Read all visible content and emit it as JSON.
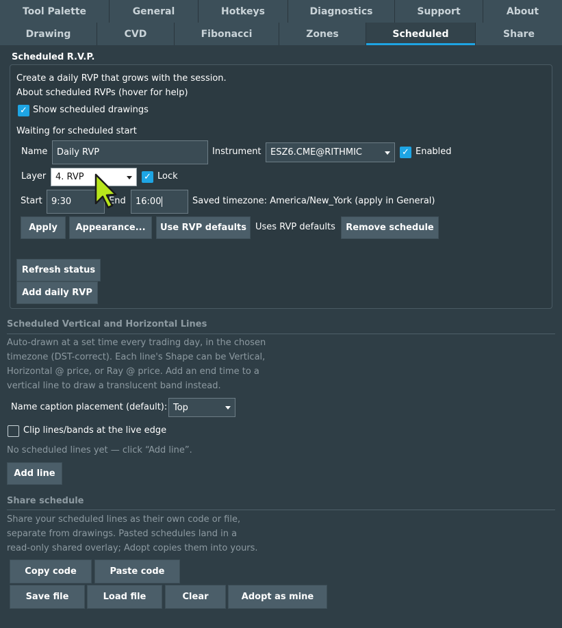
{
  "tabs_row1": [
    "Tool Palette",
    "General",
    "Hotkeys",
    "Diagnostics",
    "Support",
    "About"
  ],
  "tabs_row2": [
    "Drawing",
    "CVD",
    "Fibonacci",
    "Zones",
    "Scheduled",
    "Share"
  ],
  "active_tab": "Scheduled",
  "accent_color": "#1ea5e4",
  "rvp": {
    "title": "Scheduled R.V.P.",
    "intro": "Create a daily RVP that grows with the session.",
    "about": "About scheduled RVPs (hover for help)",
    "show_drawings_label": "Show scheduled drawings",
    "show_drawings_checked": true,
    "status": "Waiting for scheduled start",
    "name_label": "Name",
    "name_value": "Daily RVP",
    "instrument_label": "Instrument",
    "instrument_value": "ESZ6.CME@RITHMIC",
    "enabled_label": "Enabled",
    "enabled_checked": true,
    "layer_label": "Layer",
    "layer_value": "4. RVP",
    "lock_label": "Lock",
    "lock_checked": true,
    "start_label": "Start",
    "start_value": "9:30",
    "end_label": "End",
    "end_value": "16:00",
    "timezone_text": "Saved timezone: America/New_York (apply in General)",
    "apply_label": "Apply",
    "appearance_label": "Appearance...",
    "use_defaults_label": "Use RVP defaults",
    "uses_defaults_text": "Uses RVP defaults",
    "remove_label": "Remove schedule",
    "refresh_label": "Refresh status",
    "add_daily_label": "Add daily RVP"
  },
  "lines": {
    "title": "Scheduled Vertical and Horizontal Lines",
    "desc": [
      "Auto-drawn at a set time every trading day, in the chosen",
      "timezone (DST-correct). Each line's Shape can be Vertical,",
      "Horizontal @ price, or Ray @ price. Add an end time to a",
      "vertical line to draw a translucent band instead."
    ],
    "caption_label": "Name caption placement (default):",
    "caption_value": "Top",
    "clip_label": "Clip lines/bands at the live edge",
    "clip_checked": false,
    "empty_text": "No scheduled lines yet — click “Add line”.",
    "add_line_label": "Add line"
  },
  "share": {
    "title": "Share schedule",
    "desc": [
      "Share your scheduled lines as their own code or file,",
      "separate from drawings. Pasted schedules land in a",
      "read-only shared overlay; Adopt copies them into yours."
    ],
    "copy_label": "Copy code",
    "paste_label": "Paste code",
    "save_label": "Save file",
    "load_label": "Load file",
    "clear_label": "Clear",
    "adopt_label": "Adopt as mine"
  },
  "cursor": "mouse-pointer-icon"
}
